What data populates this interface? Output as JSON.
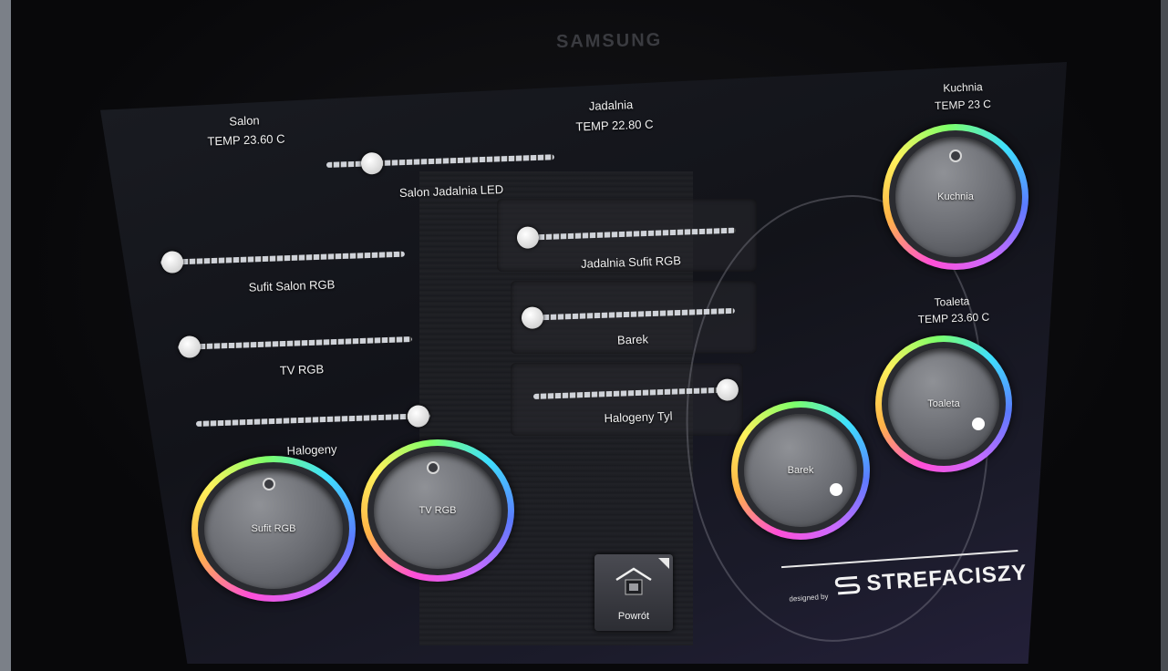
{
  "device": {
    "brand": "SAMSUNG"
  },
  "rooms": {
    "salon": {
      "name": "Salon",
      "temp": "TEMP 23.60 C"
    },
    "jadalnia": {
      "name": "Jadalnia",
      "temp": "TEMP 22.80 C"
    },
    "kuchnia": {
      "name": "Kuchnia",
      "temp": "TEMP 23 C"
    },
    "toaleta": {
      "name": "Toaleta",
      "temp": "TEMP 23.60 C"
    }
  },
  "sliders": [
    {
      "label": "Salon Jadalnia LED",
      "value": 0.2
    },
    {
      "label": "Sufit Salon RGB",
      "value": 0.05
    },
    {
      "label": "TV RGB",
      "value": 0.05
    },
    {
      "label": "Halogeny",
      "value": 0.95
    },
    {
      "label": "Jadalnia Sufit RGB",
      "value": 0.05
    },
    {
      "label": "Barek",
      "value": 0.05
    },
    {
      "label": "Halogeny Tyl",
      "value": 0.95
    }
  ],
  "knobs": {
    "kuchnia": {
      "label": "Kuchnia"
    },
    "toaleta": {
      "label": "Toaleta"
    },
    "barek": {
      "label": "Barek"
    },
    "sufit": {
      "label": "Sufit RGB"
    },
    "tv": {
      "label": "TV RGB"
    }
  },
  "nav": {
    "back_label": "Powrót"
  },
  "credits": {
    "designed_by": "designed by",
    "logo_text": "STREFACISZY"
  },
  "colors": {
    "accent_ring": "#ff4fd8",
    "thumb": "#ffffff",
    "track": "#cfd2d8"
  }
}
